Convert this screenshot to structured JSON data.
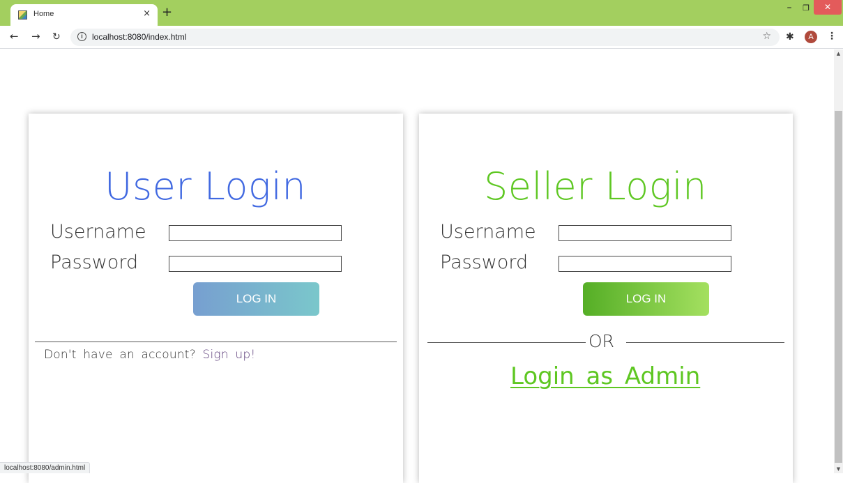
{
  "browser": {
    "tab_title": "Home",
    "tab_close": "×",
    "new_tab": "+",
    "url": "localhost:8080/index.html",
    "status_url": "localhost:8080/admin.html",
    "avatar_letter": "A",
    "theme_color": "#a3cf5f"
  },
  "user_login": {
    "title": "User Login",
    "username_label": "Username",
    "password_label": "Password",
    "username_value": "",
    "password_value": "",
    "login_button": "LOG IN",
    "signup_prefix": "Don't have an account?",
    "signup_link": "Sign up!",
    "accent_color": "#4169e1"
  },
  "seller_login": {
    "title": "Seller Login",
    "username_label": "Username",
    "password_label": "Password",
    "username_value": "",
    "password_value": "",
    "login_button": "LOG IN",
    "or_text": "OR",
    "admin_link": "Login as Admin",
    "accent_color": "#5ec722"
  }
}
